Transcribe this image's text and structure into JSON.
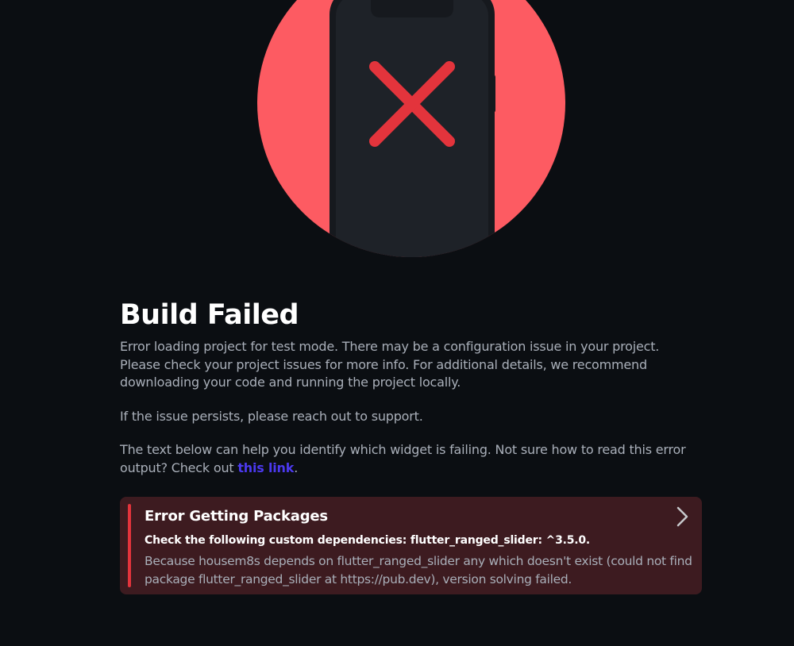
{
  "build": {
    "title": "Build Failed",
    "message": "Error loading project for test mode. There may be a configuration issue in your project. Please check your project issues for more info. For additional details, we recommend downloading your code and running the project locally.",
    "support_note": "If the issue persists, please reach out to support.",
    "help_text_before": "The text below can help you identify which widget is failing. Not sure how to read this error output? Check out ",
    "help_link": "this link",
    "help_text_after": "."
  },
  "error": {
    "title": "Error Getting Packages",
    "dependencies": "Check the following custom dependencies: flutter_ranged_slider: ^3.5.0.",
    "detail": "Because housem8s depends on flutter_ranged_slider any which doesn't exist (could not find package flutter_ranged_slider at https://pub.dev), version solving failed.",
    "chevron_icon": "chevron-right-icon"
  },
  "illustration": {
    "icon": "phone-error-icon",
    "circle_color": "#fd5b62",
    "phone_color": "#1e2228",
    "x_color": "#e3343c"
  },
  "colors": {
    "background": "#0b0e12",
    "card_background": "#3d1b20",
    "accent_red": "#e3343c",
    "link": "#4b39ef",
    "muted_text": "#a9afb9"
  }
}
